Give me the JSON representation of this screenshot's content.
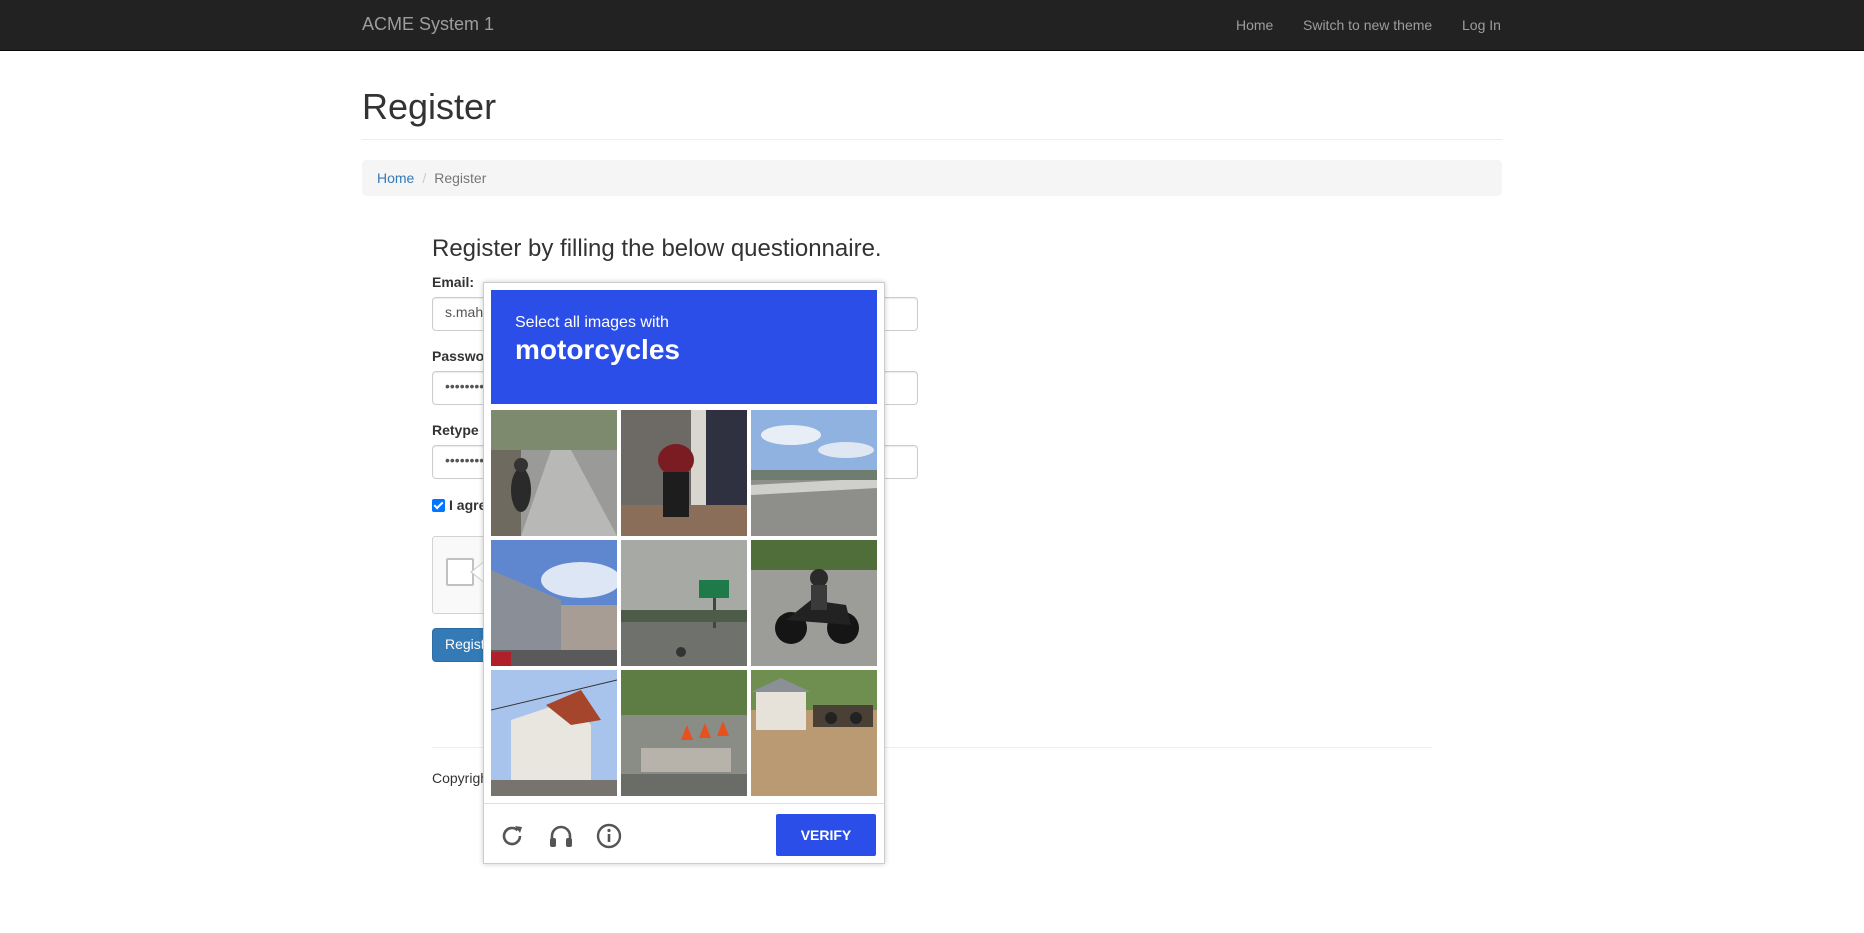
{
  "navbar": {
    "brand": "ACME System 1",
    "links": [
      "Home",
      "Switch to new theme",
      "Log In"
    ]
  },
  "page": {
    "title": "Register",
    "breadcrumb": {
      "home": "Home",
      "separator": "/",
      "current": "Register"
    }
  },
  "form": {
    "heading": "Register by filling the below questionnaire.",
    "email_label": "Email:",
    "email_value": "s.mah",
    "password_label": "Passwo",
    "password_value": "••••••••",
    "retype_label": "Retype",
    "retype_value": "••••••••",
    "agree_label": "I agre",
    "agree_checked": true,
    "register_label": "Regist"
  },
  "footer": {
    "copyright": "Copyrigh"
  },
  "captcha": {
    "instruction": "Select all images with",
    "target": "motorcycles",
    "tiles": [
      {
        "scene": "street with motorcyclist"
      },
      {
        "scene": "parked red motorcycle"
      },
      {
        "scene": "empty bridge road"
      },
      {
        "scene": "roadside shops and sky"
      },
      {
        "scene": "highway with billboard"
      },
      {
        "scene": "rider on black motorcycle"
      },
      {
        "scene": "white house and power lines"
      },
      {
        "scene": "road barriers with traffic cones"
      },
      {
        "scene": "house with parked motorcycles"
      }
    ],
    "verify_label": "VERIFY",
    "colors": {
      "accent": "#2b4ee9"
    }
  }
}
